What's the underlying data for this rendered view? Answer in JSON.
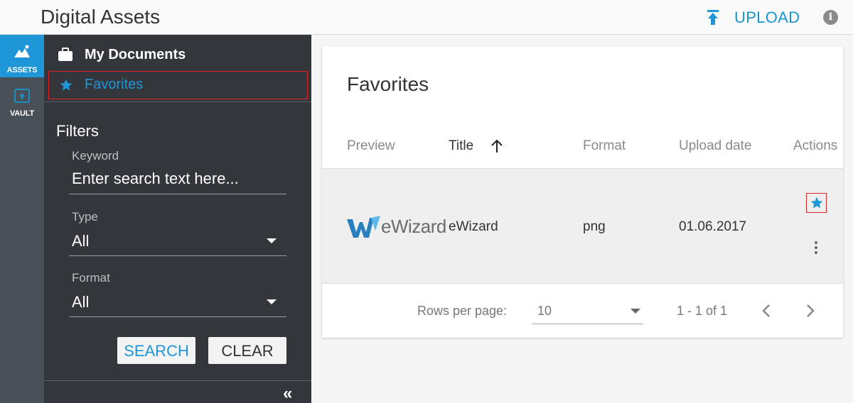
{
  "header": {
    "title": "Digital Assets",
    "upload_label": "UPLOAD",
    "info_glyph": "i",
    "accent_color": "#1e96d7"
  },
  "rail": {
    "items": [
      {
        "label": "ASSETS",
        "icon": "mountains-icon",
        "active": true
      },
      {
        "label": "VAULT",
        "icon": "vault-icon",
        "active": false
      }
    ]
  },
  "panel": {
    "nav": [
      {
        "label": "My Documents",
        "icon": "briefcase-icon"
      },
      {
        "label": "Favorites",
        "icon": "star-icon",
        "selected": true
      }
    ],
    "filters_title": "Filters",
    "keyword": {
      "label": "Keyword",
      "placeholder": "Enter search text here..."
    },
    "type": {
      "label": "Type",
      "value": "All"
    },
    "format": {
      "label": "Format",
      "value": "All"
    },
    "search_label": "SEARCH",
    "clear_label": "CLEAR",
    "collapse_glyph": "«"
  },
  "main": {
    "title": "Favorites",
    "columns": [
      "Preview",
      "Title",
      "Format",
      "Upload date",
      "Actions"
    ],
    "sort": {
      "column": "Title",
      "direction": "ascending"
    },
    "rows": [
      {
        "preview": "eWizard",
        "title": "eWizard",
        "format": "png",
        "upload_date": "01.06.2017",
        "favorite": true
      }
    ],
    "footer": {
      "rows_per_page_label": "Rows per page:",
      "rows_per_page_value": "10",
      "range": "1 - 1 of 1"
    }
  }
}
